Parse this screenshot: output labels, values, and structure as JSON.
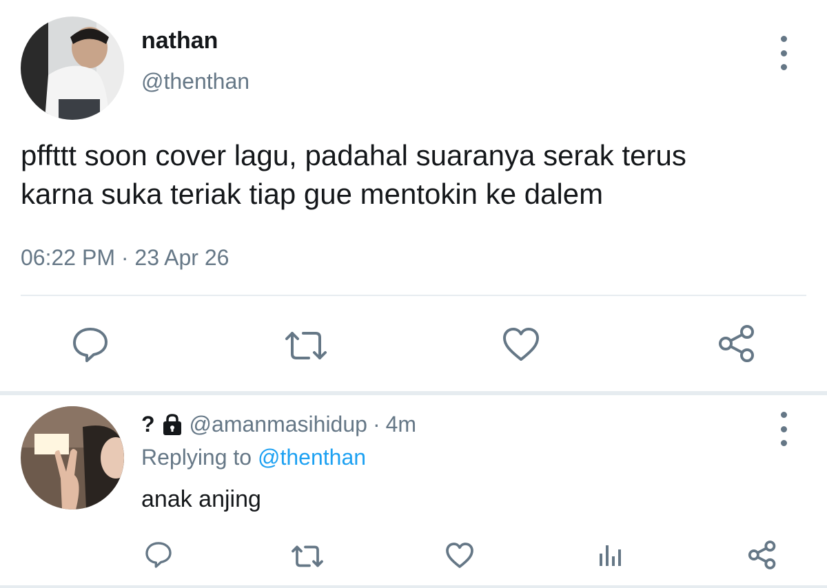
{
  "tweet": {
    "display_name": "nathan",
    "handle": "@thenthan",
    "text_line1": "pffttt soon cover lagu, padahal suaranya serak terus",
    "text_line2": "karna suka teriak tiap gue mentokin ke dalem",
    "time": "06:22 PM",
    "separator": "·",
    "date": "23 Apr 26",
    "actions": [
      "reply-icon",
      "retweet-icon",
      "like-icon",
      "share-icon"
    ]
  },
  "reply": {
    "display_name": "?",
    "lock_icon": "lock-icon",
    "handle": "@amanmasihidup",
    "separator": "·",
    "age": "4m",
    "replying_label": "Replying to",
    "replying_handle": "@thenthan",
    "text": "anak anjing",
    "actions": [
      "reply-icon",
      "retweet-icon",
      "like-icon",
      "analytics-icon",
      "share-icon"
    ]
  },
  "colors": {
    "text": "#14171a",
    "secondary": "#657786",
    "link": "#1da1f2",
    "divider": "#e6ecf0"
  }
}
